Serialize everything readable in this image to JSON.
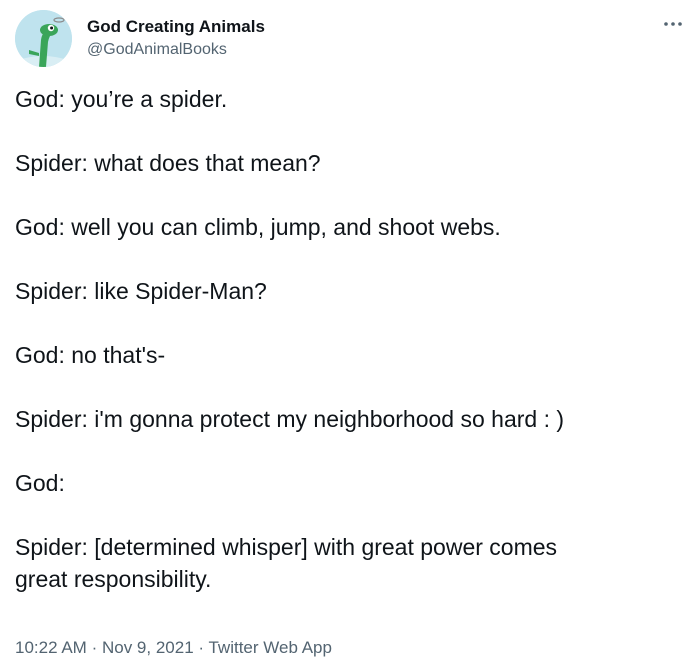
{
  "author": {
    "display_name": "God Creating Animals",
    "handle": "@GodAnimalBooks",
    "avatar_icon": "cartoon-animal-avatar-icon"
  },
  "menu_icon": "more-dots-icon",
  "tweet_lines": [
    "God: you’re a spider.",
    "Spider: what does that mean?",
    "God: well you can climb, jump, and shoot webs.",
    "Spider: like Spider-Man?",
    "God: no that's-",
    "Spider: i'm gonna protect my neighborhood so hard : )",
    "God:",
    "Spider: [determined whisper] with great power comes",
    "great responsibility."
  ],
  "footer": {
    "time": "10:22 AM",
    "separator": "·",
    "date": "Nov 9, 2021",
    "source": "Twitter Web App"
  },
  "colors": {
    "text": "#0f1419",
    "secondary": "#536471",
    "avatar_bg": "#bfe3ee",
    "avatar_figure": "#3aa55a"
  }
}
